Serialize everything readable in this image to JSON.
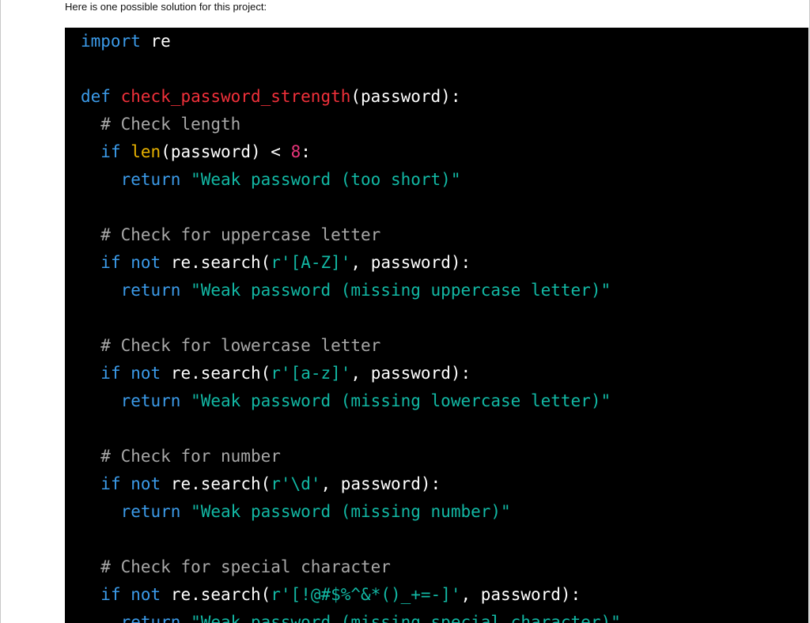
{
  "page": {
    "intro_text": "Here is one possible solution for this project:"
  },
  "code": {
    "lines": [
      [
        [
          "kw",
          "import"
        ],
        [
          "pl",
          " re"
        ]
      ],
      [],
      [
        [
          "kw",
          "def"
        ],
        [
          "pl",
          " "
        ],
        [
          "fn",
          "check_password_strength"
        ],
        [
          "pl",
          "(password):"
        ]
      ],
      [
        [
          "pl",
          "  "
        ],
        [
          "cm",
          "# Check length"
        ]
      ],
      [
        [
          "pl",
          "  "
        ],
        [
          "kw",
          "if"
        ],
        [
          "pl",
          " "
        ],
        [
          "bi",
          "len"
        ],
        [
          "pl",
          "(password) < "
        ],
        [
          "num",
          "8"
        ],
        [
          "pl",
          ":"
        ]
      ],
      [
        [
          "pl",
          "    "
        ],
        [
          "kw",
          "return"
        ],
        [
          "pl",
          " "
        ],
        [
          "str",
          "\"Weak password (too short)\""
        ]
      ],
      [],
      [
        [
          "pl",
          "  "
        ],
        [
          "cm",
          "# Check for uppercase letter"
        ]
      ],
      [
        [
          "pl",
          "  "
        ],
        [
          "kw",
          "if"
        ],
        [
          "pl",
          " "
        ],
        [
          "kw",
          "not"
        ],
        [
          "pl",
          " re.search("
        ],
        [
          "str",
          "r'[A-Z]'"
        ],
        [
          "pl",
          ", password):"
        ]
      ],
      [
        [
          "pl",
          "    "
        ],
        [
          "kw",
          "return"
        ],
        [
          "pl",
          " "
        ],
        [
          "str",
          "\"Weak password (missing uppercase letter)\""
        ]
      ],
      [],
      [
        [
          "pl",
          "  "
        ],
        [
          "cm",
          "# Check for lowercase letter"
        ]
      ],
      [
        [
          "pl",
          "  "
        ],
        [
          "kw",
          "if"
        ],
        [
          "pl",
          " "
        ],
        [
          "kw",
          "not"
        ],
        [
          "pl",
          " re.search("
        ],
        [
          "str",
          "r'[a-z]'"
        ],
        [
          "pl",
          ", password):"
        ]
      ],
      [
        [
          "pl",
          "    "
        ],
        [
          "kw",
          "return"
        ],
        [
          "pl",
          " "
        ],
        [
          "str",
          "\"Weak password (missing lowercase letter)\""
        ]
      ],
      [],
      [
        [
          "pl",
          "  "
        ],
        [
          "cm",
          "# Check for number"
        ]
      ],
      [
        [
          "pl",
          "  "
        ],
        [
          "kw",
          "if"
        ],
        [
          "pl",
          " "
        ],
        [
          "kw",
          "not"
        ],
        [
          "pl",
          " re.search("
        ],
        [
          "str",
          "r'\\d'"
        ],
        [
          "pl",
          ", password):"
        ]
      ],
      [
        [
          "pl",
          "    "
        ],
        [
          "kw",
          "return"
        ],
        [
          "pl",
          " "
        ],
        [
          "str",
          "\"Weak password (missing number)\""
        ]
      ],
      [],
      [
        [
          "pl",
          "  "
        ],
        [
          "cm",
          "# Check for special character"
        ]
      ],
      [
        [
          "pl",
          "  "
        ],
        [
          "kw",
          "if"
        ],
        [
          "pl",
          " "
        ],
        [
          "kw",
          "not"
        ],
        [
          "pl",
          " re.search("
        ],
        [
          "str",
          "r'[!@#$%^&*()_+=-]'"
        ],
        [
          "pl",
          ", password):"
        ]
      ],
      [
        [
          "pl",
          "    "
        ],
        [
          "kw",
          "return"
        ],
        [
          "pl",
          " "
        ],
        [
          "str",
          "\"Weak password (missing special character)\""
        ]
      ]
    ]
  }
}
